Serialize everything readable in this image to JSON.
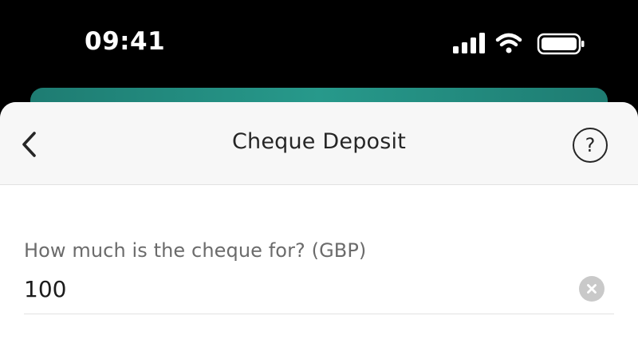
{
  "status_bar": {
    "time": "09:41",
    "icons": [
      "cellular-signal-icon",
      "wifi-icon",
      "battery-icon"
    ]
  },
  "colors": {
    "accent_teal": "#27998b",
    "status_bar_bg": "#000000",
    "nav_bg": "#f7f7f7",
    "text_primary": "#262626",
    "text_secondary": "#6b6b6b",
    "clear_icon_bg": "#c9c9c9"
  },
  "nav": {
    "back_icon": "chevron-left-icon",
    "title": "Cheque Deposit",
    "help_icon": "help-circle-icon",
    "help_glyph": "?"
  },
  "form": {
    "amount_label": "How much is the cheque for? (GBP)",
    "amount_value": "100",
    "clear_icon": "clear-x-icon"
  }
}
